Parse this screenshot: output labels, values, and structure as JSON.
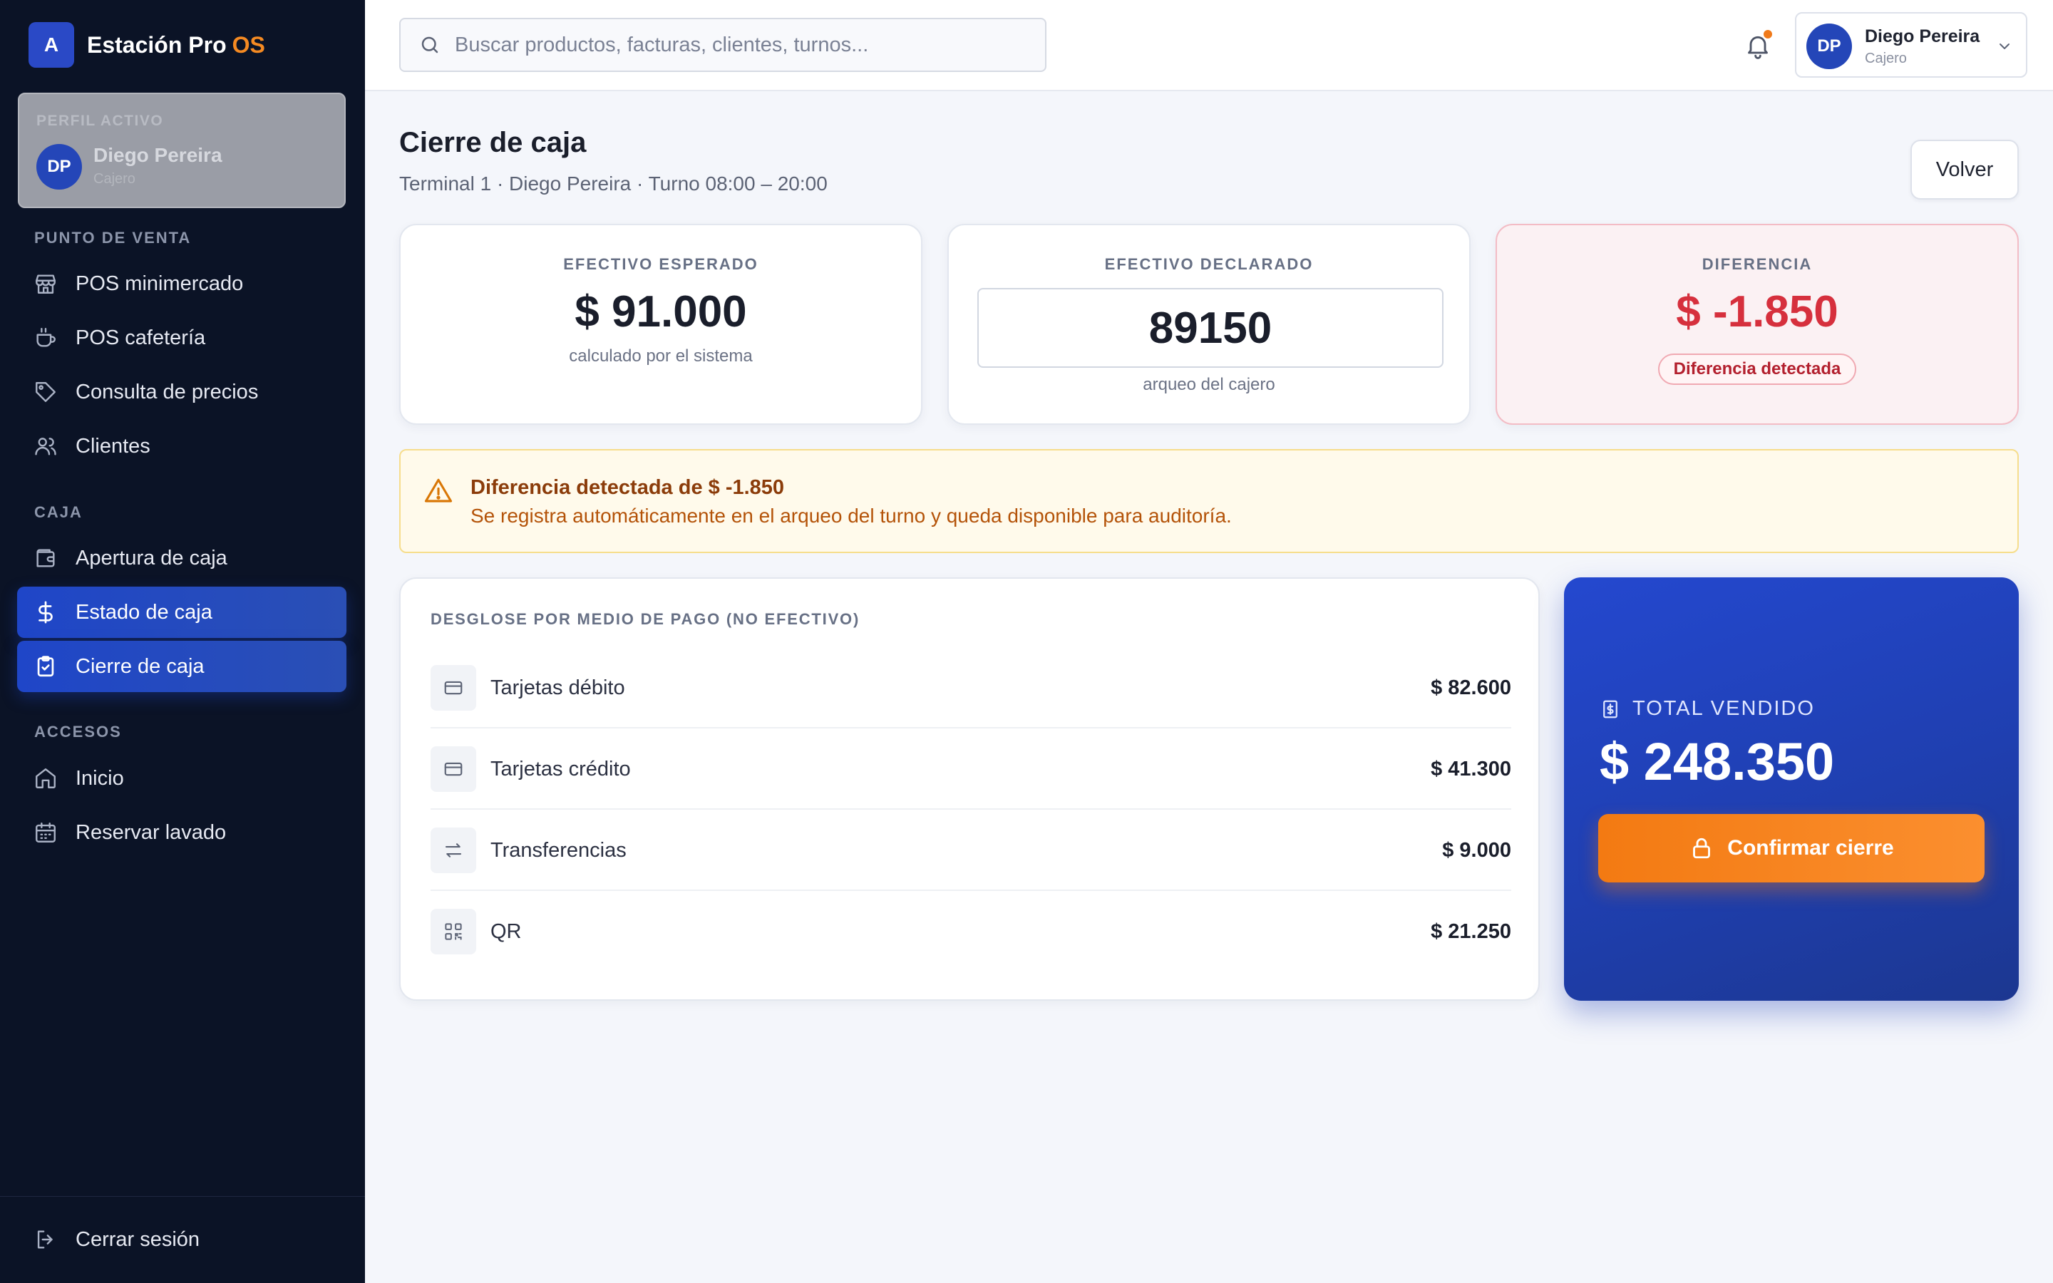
{
  "brand": {
    "logo_letter": "A",
    "name": "Estación Pro",
    "accent": "OS"
  },
  "profile": {
    "label": "PERFIL ACTIVO",
    "initials": "DP",
    "name": "Diego Pereira",
    "role": "Cajero"
  },
  "sidebar": {
    "sections": [
      {
        "label": "PUNTO DE VENTA",
        "items": [
          {
            "label": "POS minimercado",
            "icon": "store-icon"
          },
          {
            "label": "POS cafetería",
            "icon": "coffee-icon"
          },
          {
            "label": "Consulta de precios",
            "icon": "tag-icon"
          },
          {
            "label": "Clientes",
            "icon": "users-icon"
          }
        ]
      },
      {
        "label": "CAJA",
        "items": [
          {
            "label": "Apertura de caja",
            "icon": "wallet-icon"
          },
          {
            "label": "Estado de caja",
            "icon": "dollar-icon",
            "active": true
          },
          {
            "label": "Cierre de caja",
            "icon": "clipboard-check-icon",
            "active": true
          }
        ]
      },
      {
        "label": "ACCESOS",
        "items": [
          {
            "label": "Inicio",
            "icon": "home-icon"
          },
          {
            "label": "Reservar lavado",
            "icon": "calendar-icon"
          }
        ]
      }
    ],
    "logout": {
      "label": "Cerrar sesión",
      "icon": "logout-icon"
    }
  },
  "topbar": {
    "search_placeholder": "Buscar productos, facturas, clientes, turnos...",
    "user": {
      "initials": "DP",
      "name": "Diego Pereira",
      "role": "Cajero"
    }
  },
  "page": {
    "title": "Cierre de caja",
    "subtitle": "Terminal 1 · Diego Pereira · Turno 08:00 – 20:00",
    "back_label": "Volver"
  },
  "stats": {
    "expected": {
      "label": "EFECTIVO ESPERADO",
      "value": "$ 91.000",
      "note": "calculado por el sistema"
    },
    "declared": {
      "label": "EFECTIVO DECLARADO",
      "value": "89150",
      "note": "arqueo del cajero"
    },
    "difference": {
      "label": "DIFERENCIA",
      "value": "$ -1.850",
      "badge": "Diferencia detectada"
    }
  },
  "alert": {
    "title": "Diferencia detectada de $ -1.850",
    "description": "Se registra automáticamente en el arqueo del turno y queda disponible para auditoría."
  },
  "breakdown": {
    "heading": "DESGLOSE POR MEDIO DE PAGO (NO EFECTIVO)",
    "rows": [
      {
        "name": "Tarjetas débito",
        "amount": "$ 82.600",
        "icon": "credit-card-icon"
      },
      {
        "name": "Tarjetas crédito",
        "amount": "$ 41.300",
        "icon": "credit-card-icon"
      },
      {
        "name": "Transferencias",
        "amount": "$ 9.000",
        "icon": "transfer-arrows-icon"
      },
      {
        "name": "QR",
        "amount": "$ 21.250",
        "icon": "qr-code-icon"
      }
    ]
  },
  "total": {
    "label": "TOTAL VENDIDO",
    "value": "$ 248.350",
    "confirm_label": "Confirmar cierre"
  },
  "colors": {
    "sidebar_bg": "#0b1326",
    "primary": "#2448cf",
    "accent_orange": "#f58a22",
    "danger": "#d6303d",
    "warning_text": "#b45309"
  }
}
